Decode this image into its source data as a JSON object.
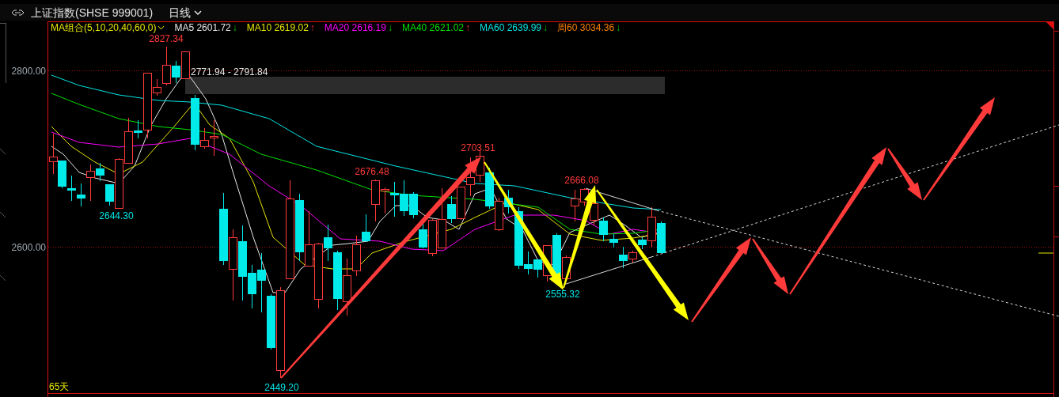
{
  "title_bar": {
    "instrument": "上证指数(SHSE 999001)",
    "period": "日线"
  },
  "ma_legend": [
    {
      "kind": "group",
      "text": "MA组合(5,10,20,40,60,0)",
      "color": "#e6e600"
    },
    {
      "kind": "line",
      "text": "MA5 2601.72",
      "arrow": "↓",
      "rising": false,
      "color": "#e8e8e8"
    },
    {
      "kind": "line",
      "text": "MA10 2619.02",
      "arrow": "↑",
      "rising": true,
      "color": "#e6e600"
    },
    {
      "kind": "line",
      "text": "MA20 2616.19",
      "arrow": "↓",
      "rising": false,
      "color": "#ff00ff"
    },
    {
      "kind": "line",
      "text": "MA40 2621.02",
      "arrow": "↑",
      "rising": true,
      "color": "#00e000"
    },
    {
      "kind": "line",
      "text": "MA60 2639.99",
      "arrow": "↓",
      "rising": false,
      "color": "#00e5e5"
    },
    {
      "kind": "line",
      "text": "周60 3034.36",
      "arrow": "↓",
      "rising": false,
      "color": "#ff8000"
    }
  ],
  "chart": {
    "y_ticks": [
      "2800.00",
      "2600.00"
    ],
    "price_labels": [
      {
        "kind": "low",
        "text": "2644.30"
      },
      {
        "kind": "high",
        "text": "2827.34"
      },
      {
        "kind": "low",
        "text": "2449.20"
      },
      {
        "kind": "high",
        "text": "2676.48"
      },
      {
        "kind": "high",
        "text": "2703.51"
      },
      {
        "kind": "low",
        "text": "2555.32"
      },
      {
        "kind": "high",
        "text": "2666.08"
      }
    ],
    "range_label": "2771.94 - 2791.84",
    "visible_days": "65天"
  }
}
